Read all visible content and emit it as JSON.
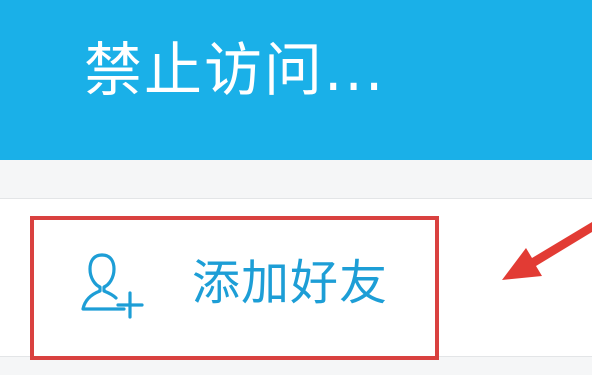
{
  "header": {
    "title": "禁止访问..."
  },
  "menu": {
    "add_friend_label": "添加好友",
    "add_friend_icon": "add-user-icon"
  },
  "annotation": {
    "highlight_color": "#d9413f",
    "arrow_color": "#e23b34"
  },
  "colors": {
    "header_bg": "#1ab0e8",
    "accent_text": "#1d9ed6"
  }
}
